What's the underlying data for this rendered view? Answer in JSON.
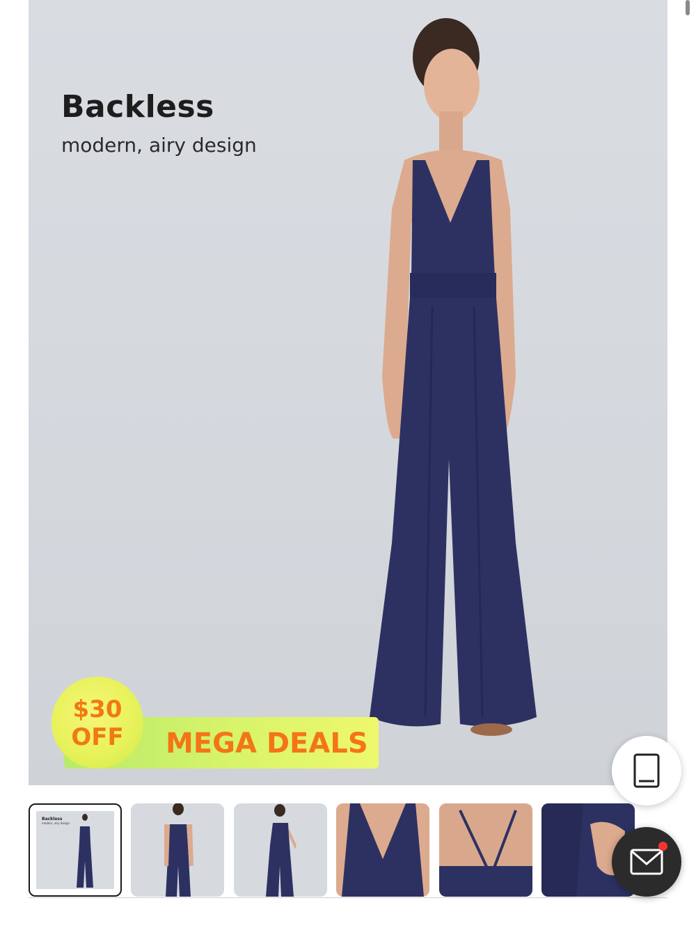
{
  "hero": {
    "title": "Backless",
    "subtitle": "modern, airy design"
  },
  "promo": {
    "amount": "$30",
    "off": "OFF",
    "label": "MEGA DEALS"
  },
  "colors": {
    "navy": "#2d3162",
    "promo_orange": "#f47515",
    "promo_green": "#c8ef66",
    "notify_red": "#f0352f"
  },
  "thumbnails": {
    "selected_index": 0,
    "items": [
      {
        "title": "Backless",
        "subtitle": "modern, airy design"
      },
      {},
      {},
      {},
      {},
      {}
    ]
  },
  "fabs": {
    "device_icon": "phone-icon",
    "mail_icon": "mail-icon",
    "mail_has_notification": true
  }
}
